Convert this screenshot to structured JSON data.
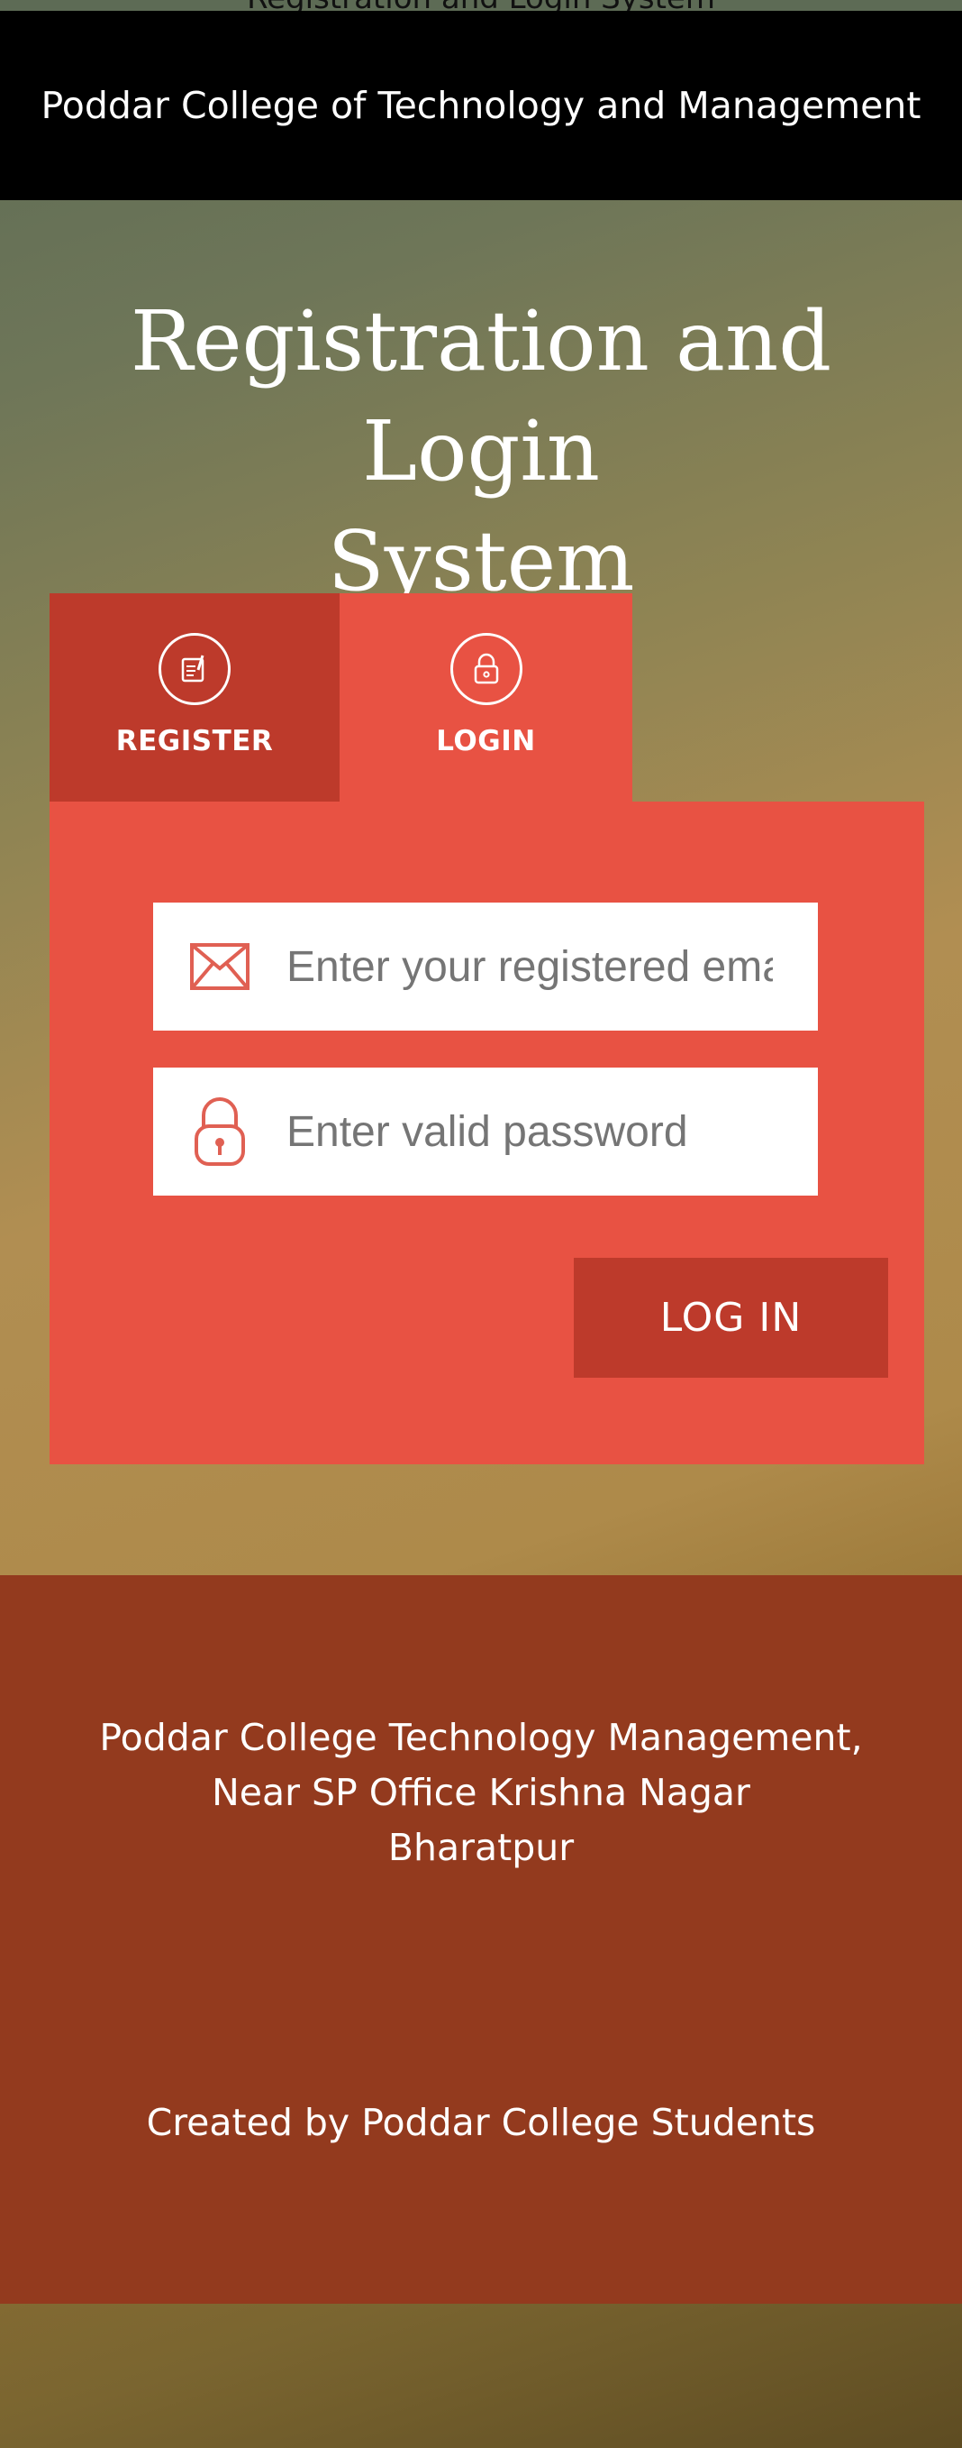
{
  "header": {
    "clipped_text": "Registration and Login System",
    "college_name": "Poddar College of Technology and Management"
  },
  "page_title": {
    "line1": "Registration and Login",
    "line2": "System"
  },
  "tabs": [
    {
      "label": "REGISTER",
      "icon": "register-form-icon"
    },
    {
      "label": "LOGIN",
      "icon": "lock-icon"
    }
  ],
  "login_form": {
    "email_placeholder": "Enter your registered email",
    "email_icon": "envelope-icon",
    "password_placeholder": "Enter valid password",
    "password_icon": "lock-icon",
    "submit_label": "LOG IN"
  },
  "footer": {
    "address_line1": "Poddar College Technology Management,",
    "address_line2": "Near SP Office Krishna Nagar",
    "address_line3": "Bharatpur",
    "credit": "Created by Poddar College Students"
  },
  "colors": {
    "header_bg": "#000000",
    "tab_register_bg": "#bd3a2b",
    "tab_login_bg": "#e85243",
    "panel_bg": "#e85243",
    "button_bg": "#bd3a2b",
    "footer_bg": "#933a1e"
  }
}
